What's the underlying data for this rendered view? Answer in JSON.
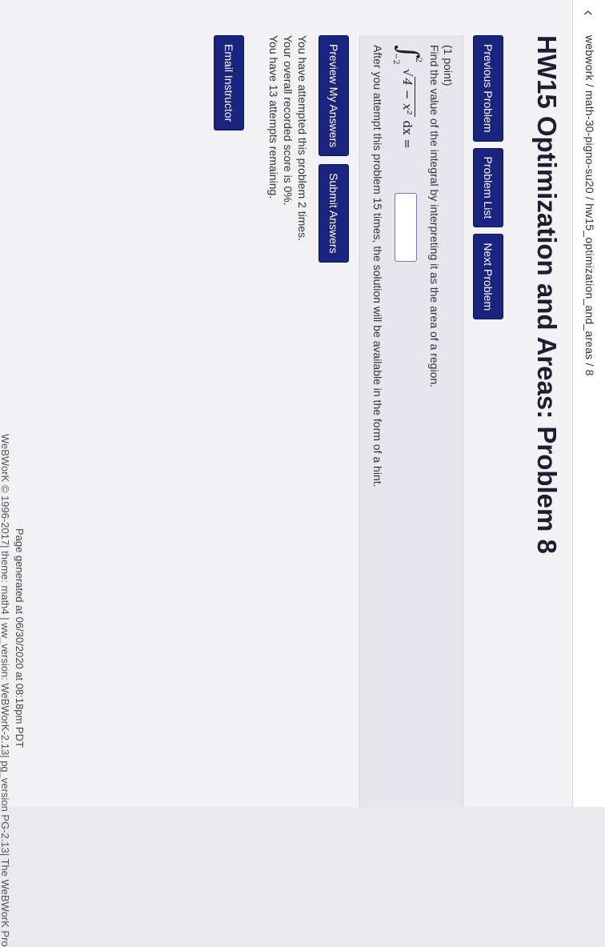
{
  "header": {
    "breadcrumb": "webwork / math-30-pigno-su20 / hw15_optimization_and_areas / 8",
    "back_icon": "chevron-left-icon"
  },
  "page": {
    "title": "HW15 Optimization and Areas: Problem 8"
  },
  "nav": {
    "previous_label": "Previous Problem",
    "list_label": "Problem List",
    "next_label": "Next Problem"
  },
  "problem": {
    "points": "(1 point)",
    "question": "Find the value of the integral by interpreting it as the area of a region.",
    "math": {
      "lower_limit": "−2",
      "upper_limit": "2",
      "radicand": "4 − x²",
      "dx": "dx ="
    },
    "answer_value": "",
    "hint_notice": "After you attempt this problem 15 times, the solution will be available in the form of a hint."
  },
  "actions": {
    "preview_label": "Preview My Answers",
    "submit_label": "Submit Answers"
  },
  "status": {
    "attempted": "You have attempted this problem 2 times.",
    "score": "Your overall recorded score is 0%.",
    "remaining": "You have 13 attempts remaining."
  },
  "email": {
    "label": "Email Instructor"
  },
  "footer": {
    "generated": "Page generated at 06/30/2020 at 08:18pm PDT",
    "version": "WeBWorK © 1996-2017| theme: math4 | ww_version: WeBWorK-2.13| pg_version PG-2.13| The WeBWorK Pro"
  },
  "colors": {
    "button_bg": "#1a237e",
    "page_bg": "#f2f2f5",
    "problem_bg": "#e6e6ec"
  }
}
